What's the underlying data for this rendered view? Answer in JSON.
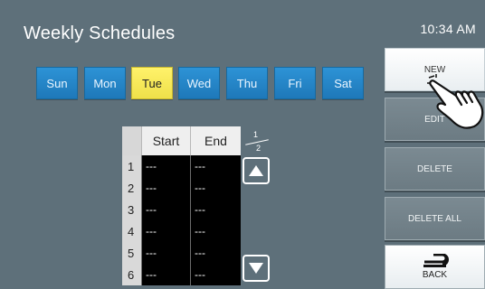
{
  "header": {
    "title": "Weekly Schedules",
    "time": "10:34 AM"
  },
  "days": [
    "Sun",
    "Mon",
    "Tue",
    "Wed",
    "Thu",
    "Fri",
    "Sat"
  ],
  "selected_day": "Tue",
  "table": {
    "headers": [
      "Start",
      "End"
    ],
    "rows": [
      {
        "num": "1",
        "start": "---",
        "end": "---"
      },
      {
        "num": "2",
        "start": "---",
        "end": "---"
      },
      {
        "num": "3",
        "start": "---",
        "end": "---"
      },
      {
        "num": "4",
        "start": "---",
        "end": "---"
      },
      {
        "num": "5",
        "start": "---",
        "end": "---"
      },
      {
        "num": "6",
        "start": "---",
        "end": "---"
      }
    ]
  },
  "pager": {
    "current": "1",
    "total": "2"
  },
  "actions": {
    "new": "NEW",
    "edit": "EDIT",
    "delete": "DELETE",
    "delete_all": "DELETE ALL",
    "back": "BACK"
  },
  "colors": {
    "background": "#5e707a",
    "day_tab": "#2389c9",
    "day_selected": "#f7ea58",
    "button": "#73828a",
    "button_active": "#ffffff"
  },
  "icons": {
    "up": "triangle-up-icon",
    "down": "triangle-down-icon",
    "back": "return-arrow-icon",
    "pointer": "hand-pointer-icon"
  }
}
